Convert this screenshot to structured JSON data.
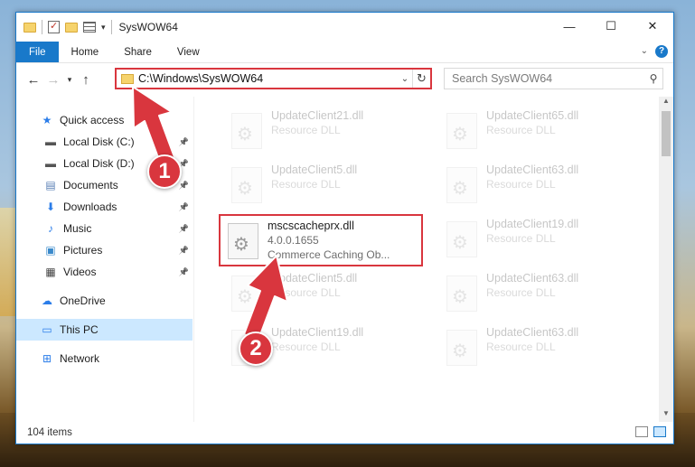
{
  "window": {
    "title": "SysWOW64",
    "controls": {
      "minimize": "—",
      "maximize": "☐",
      "close": "✕"
    }
  },
  "ribbon": {
    "tabs": [
      "File",
      "Home",
      "Share",
      "View"
    ],
    "help": "?"
  },
  "address": {
    "path": "C:\\Windows\\SysWOW64",
    "search_placeholder": "Search SysWOW64"
  },
  "sidebar": {
    "items": [
      {
        "label": "Quick access",
        "icon": "star-icon",
        "pinned": false
      },
      {
        "label": "Local Disk (C:)",
        "icon": "drive-icon",
        "pinned": true
      },
      {
        "label": "Local Disk (D:)",
        "icon": "drive-icon",
        "pinned": true
      },
      {
        "label": "Documents",
        "icon": "documents-icon",
        "pinned": true
      },
      {
        "label": "Downloads",
        "icon": "downloads-icon",
        "pinned": true
      },
      {
        "label": "Music",
        "icon": "music-icon",
        "pinned": true
      },
      {
        "label": "Pictures",
        "icon": "pictures-icon",
        "pinned": true
      },
      {
        "label": "Videos",
        "icon": "videos-icon",
        "pinned": true
      },
      {
        "label": "OneDrive",
        "icon": "cloud-icon",
        "pinned": false
      },
      {
        "label": "This PC",
        "icon": "computer-icon",
        "pinned": false,
        "selected": true
      },
      {
        "label": "Network",
        "icon": "network-icon",
        "pinned": false
      }
    ]
  },
  "files": [
    {
      "name": "UpdateClient21.dll",
      "sub": "Resource DLL",
      "faded": true
    },
    {
      "name": "UpdateClient65.dll",
      "sub": "Resource DLL",
      "faded": true
    },
    {
      "name": "UpdateClient5.dll",
      "sub": "Resource DLL",
      "faded": true
    },
    {
      "name": "UpdateClient63.dll",
      "sub": "Resource DLL",
      "faded": true
    },
    {
      "name": "mscscacheprx.dll",
      "version": "4.0.0.1655",
      "sub": "Commerce Caching Ob...",
      "highlighted": true
    },
    {
      "name": "UpdateClient19.dll",
      "sub": "Resource DLL",
      "faded": true
    },
    {
      "name": "UpdateClient5.dll",
      "sub": "Resource DLL",
      "faded": true
    },
    {
      "name": "UpdateClient63.dll",
      "sub": "Resource DLL",
      "faded": true
    },
    {
      "name": "UpdateClient19.dll",
      "sub": "Resource DLL",
      "faded": true
    },
    {
      "name": "UpdateClient63.dll",
      "sub": "Resource DLL",
      "faded": true
    }
  ],
  "status": {
    "item_count": "104 items"
  },
  "annotations": {
    "step1": "1",
    "step2": "2",
    "color": "#d9363e"
  }
}
